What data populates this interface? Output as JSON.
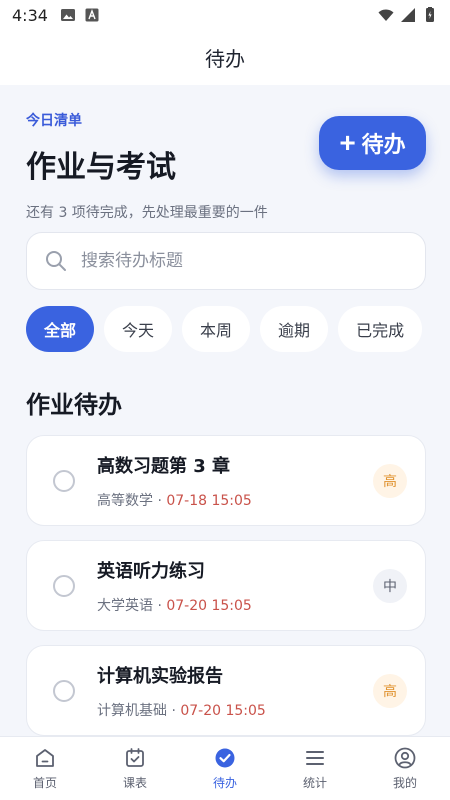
{
  "status_bar": {
    "time": "4:34",
    "left_icons": [
      "image-icon",
      "font-a-icon"
    ],
    "right_icons": [
      "wifi-icon",
      "signal-icon",
      "battery-icon"
    ]
  },
  "top_bar": {
    "title": "待办"
  },
  "header": {
    "eyebrow": "今日清单",
    "title": "作业与考试",
    "subtitle": "还有 3 项待完成，先处理最重要的一件"
  },
  "add_button": {
    "plus": "+",
    "label": "待办"
  },
  "search": {
    "placeholder": "搜索待办标题",
    "value": ""
  },
  "filters": [
    {
      "label": "全部",
      "active": true
    },
    {
      "label": "今天",
      "active": false
    },
    {
      "label": "本周",
      "active": false
    },
    {
      "label": "逾期",
      "active": false
    },
    {
      "label": "已完成",
      "active": false
    }
  ],
  "section": {
    "title": "作业待办"
  },
  "tasks": [
    {
      "title": "高数习题第 3 章",
      "course": "高等数学",
      "separator": " · ",
      "due": "07-18 15:05",
      "priority": "高"
    },
    {
      "title": "英语听力练习",
      "course": "大学英语",
      "separator": " · ",
      "due": "07-20 15:05",
      "priority": "中"
    },
    {
      "title": "计算机实验报告",
      "course": "计算机基础",
      "separator": " · ",
      "due": "07-20 15:05",
      "priority": "高"
    }
  ],
  "bottom_nav": [
    {
      "label": "首页",
      "icon": "home-icon",
      "active": false
    },
    {
      "label": "课表",
      "icon": "calendar-check-icon",
      "active": false
    },
    {
      "label": "待办",
      "icon": "check-circle-icon",
      "active": true
    },
    {
      "label": "统计",
      "icon": "menu-lines-icon",
      "active": false
    },
    {
      "label": "我的",
      "icon": "user-circle-icon",
      "active": false
    }
  ],
  "colors": {
    "accent": "#3a63e0",
    "eyebrow": "#3a5bd9",
    "due_date": "#c9524a",
    "priority_high_bg": "#fff4e6",
    "priority_high_text": "#e0922f",
    "priority_mid_bg": "#f0f2f7",
    "background": "#f4f6fb"
  }
}
